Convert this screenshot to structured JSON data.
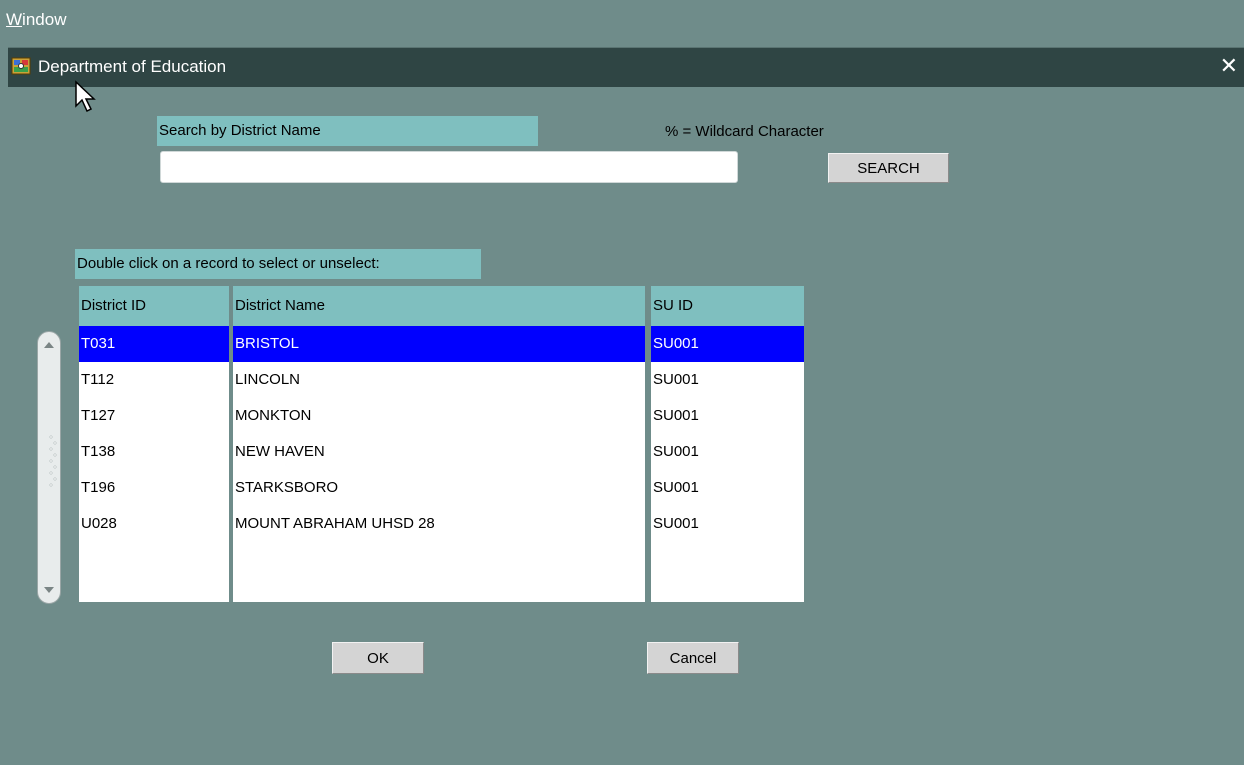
{
  "menubar": {
    "window_menu_mnemonic": "W",
    "window_menu_rest": "indow"
  },
  "dialog": {
    "title": "Department of Education",
    "close_glyph": "✕"
  },
  "search": {
    "label": "Search by District Name",
    "wildcard_note": "% = Wildcard Character",
    "value": "",
    "button_label": "SEARCH"
  },
  "instruction": "Double click on a record to select or unselect:",
  "table": {
    "columns": [
      "District ID",
      "District Name",
      "SU ID"
    ],
    "rows": [
      {
        "district_id": "T031",
        "district_name": "BRISTOL",
        "su_id": "SU001",
        "selected": true
      },
      {
        "district_id": "T112",
        "district_name": "LINCOLN",
        "su_id": "SU001",
        "selected": false
      },
      {
        "district_id": "T127",
        "district_name": "MONKTON",
        "su_id": "SU001",
        "selected": false
      },
      {
        "district_id": "T138",
        "district_name": "NEW HAVEN",
        "su_id": "SU001",
        "selected": false
      },
      {
        "district_id": "T196",
        "district_name": "STARKSBORO",
        "su_id": "SU001",
        "selected": false
      },
      {
        "district_id": "U028",
        "district_name": "MOUNT ABRAHAM UHSD 28",
        "su_id": "SU001",
        "selected": false
      }
    ]
  },
  "buttons": {
    "ok_label": "OK",
    "cancel_label": "Cancel"
  },
  "icons": {
    "app": "app-icon",
    "close": "close-icon",
    "cursor": "mouse-pointer-icon",
    "scroll_up": "scroll-up-arrow-icon",
    "scroll_down": "scroll-down-arrow-icon"
  },
  "colors": {
    "background": "#6f8c8a",
    "titlebar": "#2f4544",
    "header_teal": "#7fbfbf",
    "selection": "#0000ff"
  }
}
